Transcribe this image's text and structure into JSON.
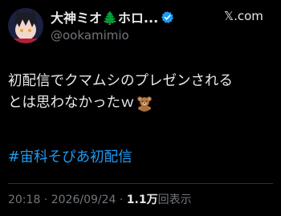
{
  "author": {
    "display_name": "大神ミオ🌲ホロ...",
    "handle": "@ookamimio"
  },
  "brand": {
    "label": "𝕏.com"
  },
  "tweet": {
    "line1": "初配信でクマムシのプレゼンされる",
    "line2": "とは思わなかったｗ",
    "hashtag": "#宙科そぴあ初配信"
  },
  "meta": {
    "time": "20:18",
    "sep1": " · ",
    "date": "2026/09/24",
    "sep2": " · ",
    "views_count": "1.1万",
    "views_label": "回表示"
  },
  "colors": {
    "background": "#000000",
    "text": "#e7e9ea",
    "secondary": "#71767b",
    "link": "#1d9bf0",
    "verified": "#1d9bf0"
  }
}
